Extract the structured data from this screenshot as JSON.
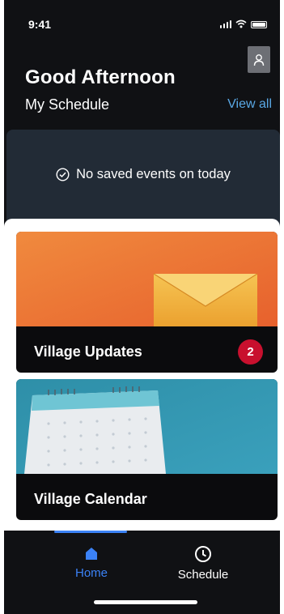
{
  "status_bar": {
    "time": "9:41"
  },
  "header": {
    "greeting": "Good Afternoon",
    "schedule_title": "My Schedule",
    "view_all": "View all"
  },
  "events": {
    "empty_message": "No saved events on today"
  },
  "cards": [
    {
      "title": "Village Updates",
      "badge": "2",
      "image": "envelope-illustration"
    },
    {
      "title": "Village Calendar",
      "image": "wall-calendar-illustration"
    }
  ],
  "tab_bar": {
    "items": [
      {
        "label": "Home",
        "icon": "house-icon",
        "active": true
      },
      {
        "label": "Schedule",
        "icon": "clock-icon",
        "active": false
      }
    ]
  },
  "colors": {
    "background": "#101114",
    "panel": "#222b36",
    "accent": "#3b82f6",
    "link": "#5aa9e6",
    "badge": "#c8102e"
  }
}
